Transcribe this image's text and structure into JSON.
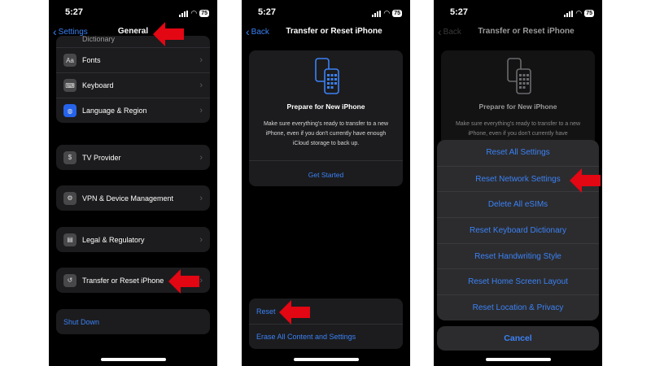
{
  "status": {
    "time": "5:27",
    "battery": "75"
  },
  "screen1": {
    "back_label": "Settings",
    "title": "General",
    "partial_row": "Dictionary",
    "group_a": [
      {
        "label": "Fonts",
        "icon": "Aa"
      },
      {
        "label": "Keyboard",
        "icon": "⌨"
      },
      {
        "label": "Language & Region",
        "icon": "◍"
      }
    ],
    "tv_provider": "TV Provider",
    "vpn": "VPN & Device Management",
    "legal": "Legal & Regulatory",
    "transfer": "Transfer or Reset iPhone",
    "shutdown": "Shut Down"
  },
  "screen2": {
    "back_label": "Back",
    "title": "Transfer or Reset iPhone",
    "card_title": "Prepare for New iPhone",
    "card_body": "Make sure everything's ready to transfer to a new iPhone, even if you don't currently have enough iCloud storage to back up.",
    "get_started": "Get Started",
    "reset": "Reset",
    "erase": "Erase All Content and Settings"
  },
  "screen3": {
    "back_label": "Back",
    "title": "Transfer or Reset iPhone",
    "card_title": "Prepare for New iPhone",
    "card_body": "Make sure everything's ready to transfer to a new iPhone, even if you don't currently have",
    "options": [
      "Reset All Settings",
      "Reset Network Settings",
      "Delete All eSIMs",
      "Reset Keyboard Dictionary",
      "Reset Handwriting Style",
      "Reset Home Screen Layout",
      "Reset Location & Privacy"
    ],
    "cancel": "Cancel"
  },
  "colors": {
    "accent": "#3b82f6",
    "arrow": "#e30613",
    "cell": "#1c1c1e",
    "sheet": "#2c2c2e"
  }
}
